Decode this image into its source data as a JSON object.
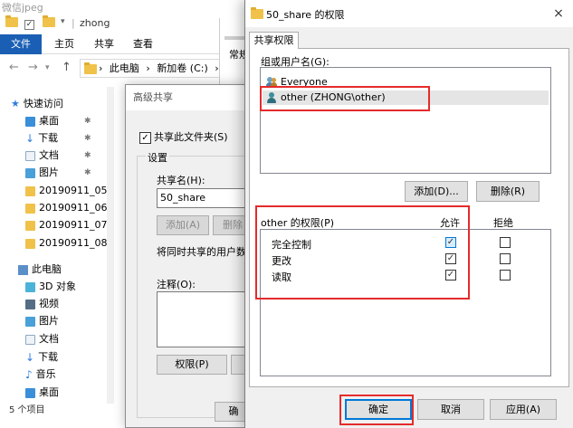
{
  "explorer": {
    "watermark": "微信jpeg",
    "path_sep": "|",
    "title": "zhong",
    "ribbon_tabs": [
      "文件",
      "主页",
      "共享",
      "查看"
    ],
    "address": {
      "computer": "此电脑",
      "drive": "新加卷 (C:)",
      "sep": "›"
    },
    "quick_access_label": "快速访问",
    "quick_items": [
      "桌面",
      "下载",
      "文档",
      "图片"
    ],
    "folders": [
      "20190911_05",
      "20190911_06",
      "20190911_07",
      "20190911_08"
    ],
    "pc_label": "此电脑",
    "pc_items": [
      "3D 对象",
      "视频",
      "图片",
      "文档",
      "下载",
      "音乐",
      "桌面"
    ],
    "status": "5 个项目",
    "bg_window_label": "常规"
  },
  "advanced": {
    "title": "高级共享",
    "share_checkbox": "共享此文件夹(S)",
    "settings_label": "设置",
    "share_name_label": "共享名(H):",
    "share_name_value": "50_share",
    "add_button": "添加(A)",
    "remove_button": "删除",
    "limit_label": "将同时共享的用户数量",
    "comment_label": "注释(O):",
    "permissions_button": "权限(P)",
    "bottom_button": "确"
  },
  "permissions": {
    "title": "50_share 的权限",
    "close": "×",
    "tab": "共享权限",
    "group_label": "组或用户名(G):",
    "users": [
      {
        "name": "Everyone",
        "selected": false
      },
      {
        "name": "other (ZHONG\\other)",
        "selected": true
      }
    ],
    "add_button": "添加(D)...",
    "remove_button": "删除(R)",
    "perm_header": "other 的权限(P)",
    "allow_header": "允许",
    "deny_header": "拒绝",
    "rows": [
      {
        "label": "完全控制",
        "allow": "✓",
        "deny": ""
      },
      {
        "label": "更改",
        "allow": "✓",
        "deny": ""
      },
      {
        "label": "读取",
        "allow": "✓",
        "deny": ""
      }
    ],
    "ok_button": "确定",
    "cancel_button": "取消",
    "apply_button": "应用(A)"
  },
  "colors": {
    "highlight": "#e52b2b",
    "ribbon_file": "#1a5fb4",
    "folder": "#f0c24a"
  }
}
